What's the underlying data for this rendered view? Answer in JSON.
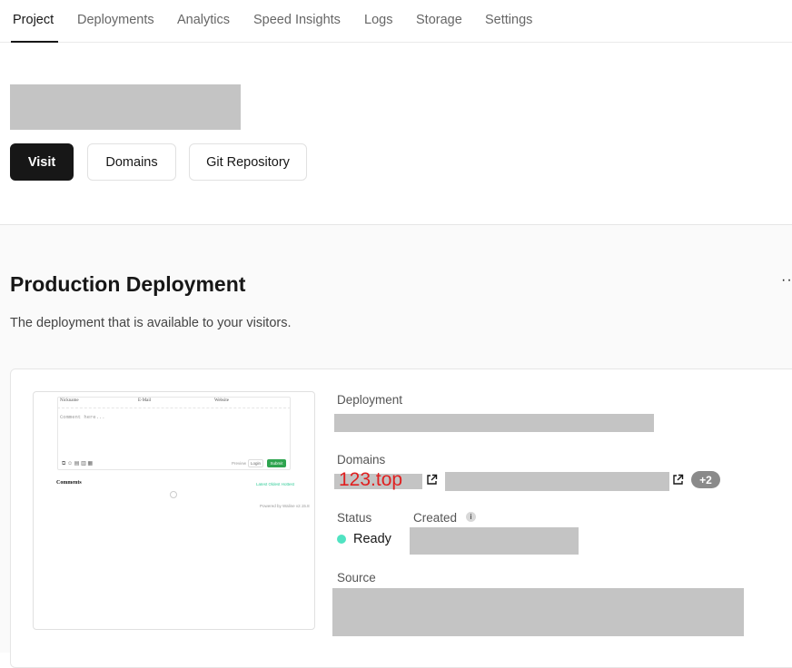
{
  "nav": {
    "tabs": [
      "Project",
      "Deployments",
      "Analytics",
      "Speed Insights",
      "Logs",
      "Storage",
      "Settings"
    ],
    "active_tab": "Project"
  },
  "header": {
    "buttons": {
      "visit": "Visit",
      "domains": "Domains",
      "git": "Git Repository"
    }
  },
  "production": {
    "title": "Production Deployment",
    "description": "The deployment that is available to your visitors.",
    "more": "··",
    "labels": {
      "deployment": "Deployment",
      "domains": "Domains",
      "status": "Status",
      "created": "Created",
      "source": "Source"
    },
    "domain_primary": "123.top",
    "domain_extra_badge": "+2",
    "status_value": "Ready",
    "info_glyph": "i",
    "status_color": "#50e3c2"
  },
  "preview": {
    "field_labels": [
      "Nickname",
      "E-Mail",
      "Website"
    ],
    "placeholder": "Comment here...",
    "icons": "⧉ ☺ ▤ ▥ ▦",
    "preview_label": "Preview",
    "login": "Login",
    "submit": "Submit",
    "comments_title": "Comments",
    "sort_options": "Latest  Oldest  Hottest",
    "powered_by": "Powered by Waline v2.15.8"
  }
}
